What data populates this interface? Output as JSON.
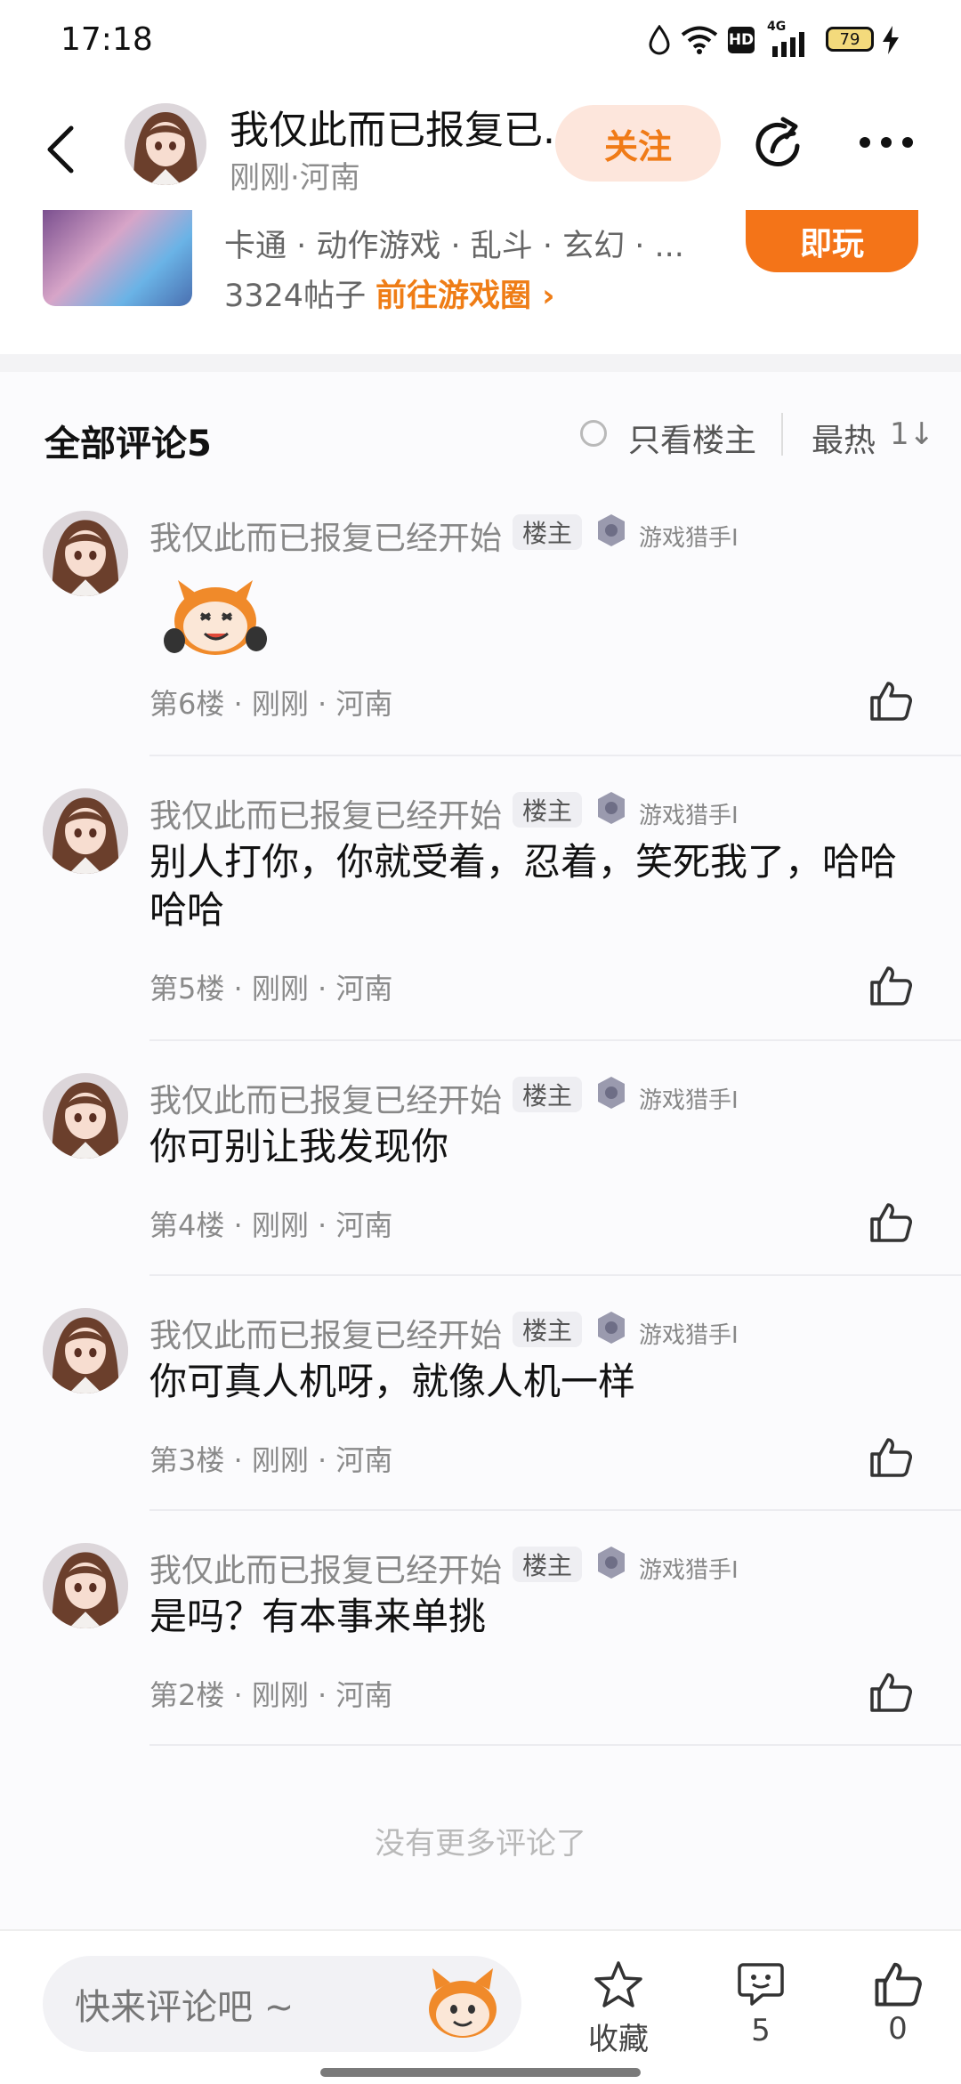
{
  "status_bar": {
    "time": "17:18",
    "icons": [
      "water-drop-icon",
      "wifi-icon",
      "hd-icon",
      "4g-signal-icon",
      "battery-icon",
      "charging-icon"
    ],
    "battery": "79",
    "network": "4G",
    "hd": "HD"
  },
  "header": {
    "title": "我仅此而已报复已...",
    "subtitle": "刚刚·河南",
    "follow_label": "关注"
  },
  "game_card": {
    "tags": "卡通 · 动作游戏 · 乱斗 · 玄幻 · ...",
    "posts": "3324帖子",
    "link": "前往游戏圈 ›",
    "play_label": "即玩"
  },
  "comments_section": {
    "title": "全部评论5",
    "op_only": "只看楼主",
    "sort": "最热",
    "sort_icon": "1↓"
  },
  "comments": [
    {
      "name": "我仅此而已报复已经开始",
      "badge": "楼主",
      "level": "游戏猎手I",
      "text": "",
      "sticker": "mascot-sticker",
      "floor": "第6楼 · 刚刚 · 河南"
    },
    {
      "name": "我仅此而已报复已经开始",
      "badge": "楼主",
      "level": "游戏猎手I",
      "text": "别人打你，你就受着，忍着，笑死我了，哈哈哈哈",
      "floor": "第5楼 · 刚刚 · 河南"
    },
    {
      "name": "我仅此而已报复已经开始",
      "badge": "楼主",
      "level": "游戏猎手I",
      "text": "你可别让我发现你",
      "floor": "第4楼 · 刚刚 · 河南"
    },
    {
      "name": "我仅此而已报复已经开始",
      "badge": "楼主",
      "level": "游戏猎手I",
      "text": "你可真人机呀，就像人机一样",
      "floor": "第3楼 · 刚刚 · 河南"
    },
    {
      "name": "我仅此而已报复已经开始",
      "badge": "楼主",
      "level": "游戏猎手I",
      "text": "是吗？有本事来单挑",
      "floor": "第2楼 · 刚刚 · 河南"
    }
  ],
  "no_more": "没有更多评论了",
  "bottom_bar": {
    "input_placeholder": "快来评论吧 ~",
    "favorite_label": "收藏",
    "comment_count": "5",
    "like_count": "0"
  },
  "colors": {
    "accent": "#f47418",
    "follow_bg": "#fde6dc",
    "link": "#ef7d16"
  }
}
